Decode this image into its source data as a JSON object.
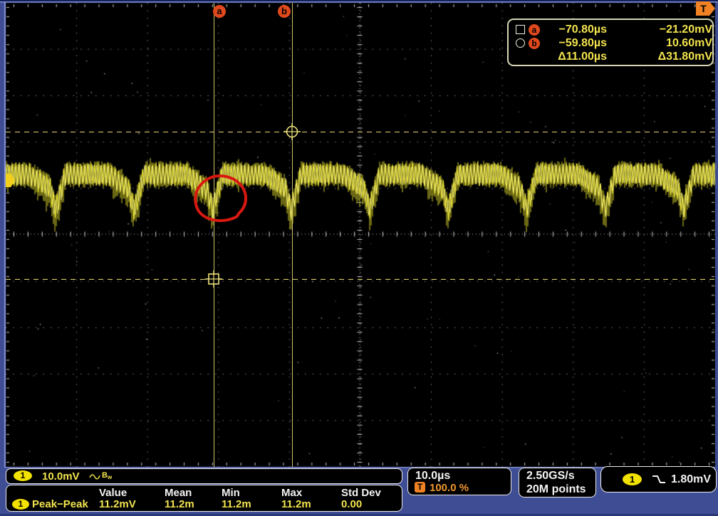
{
  "colors": {
    "frame_blue": "#3f4d94",
    "screen_black": "#000000",
    "trace_yellow": "#e8e238",
    "readout_yellow": "#f2e34e",
    "cursor_marker_orange": "#e0491d",
    "trigger_orange": "#f08224",
    "annotation_red": "#d81910"
  },
  "trigger_position_indicator": "T",
  "cursors": {
    "a": {
      "label": "a",
      "time": "−70.80µs",
      "voltage": "−21.20mV",
      "marker_shape": "square"
    },
    "b": {
      "label": "b",
      "time": "−59.80µs",
      "voltage": "10.60mV",
      "marker_shape": "circle"
    },
    "delta_time": "Δ11.00µs",
    "delta_voltage": "Δ31.80mV"
  },
  "channel_bar": {
    "channel_badge": "1",
    "vertical_scale": "10.0mV",
    "coupling_icon": "ac-sine",
    "bandwidth_label": "B",
    "bandwidth_sub": "w"
  },
  "measurements": {
    "headers": [
      "Value",
      "Mean",
      "Min",
      "Max",
      "Std Dev"
    ],
    "rows": [
      {
        "source_badge": "1",
        "name": "Peak−Peak",
        "values": [
          "11.2mV",
          "11.2m",
          "11.2m",
          "11.2m",
          "0.00"
        ]
      }
    ]
  },
  "timebase": {
    "scale": "10.0µs",
    "position_indicator": "T",
    "horizontal_position": "100.0 %"
  },
  "acquisition": {
    "sample_rate": "2.50GS/s",
    "record_length": "20M points"
  },
  "trigger": {
    "source_badge": "1",
    "slope": "falling",
    "level": "1.80mV"
  }
}
